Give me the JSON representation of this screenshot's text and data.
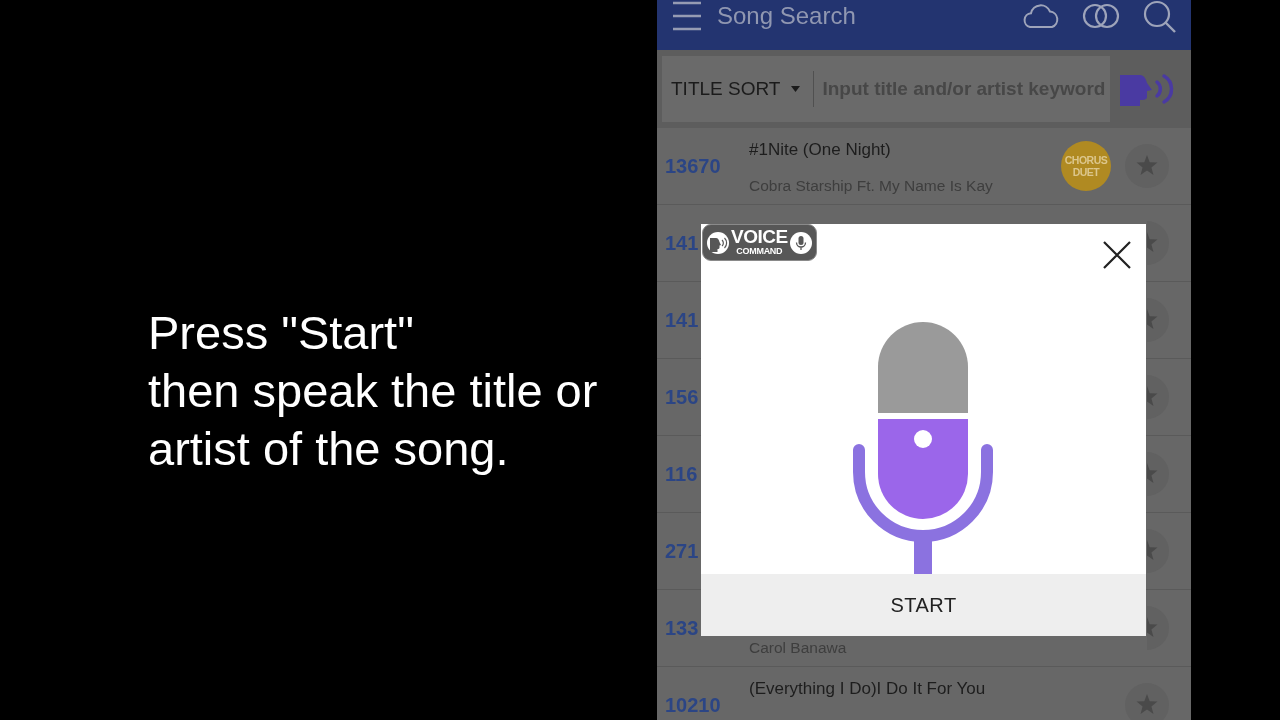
{
  "caption": {
    "text": "Press \"Start\"\nthen speak the title or\nartist of the song."
  },
  "app_bar": {
    "title": "Song Search"
  },
  "search": {
    "sort": "TITLE SORT",
    "placeholder": "Input title and/or artist keyword"
  },
  "songs": [
    {
      "number": "13670",
      "title": "#1Nite (One Night)",
      "artist": "Cobra Starship Ft. My Name Is Kay",
      "badge": {
        "text": "CHORUS\nDUET",
        "color": "#b08a22"
      }
    },
    {
      "number": "141"
    },
    {
      "number": "141"
    },
    {
      "number": "156"
    },
    {
      "number": "116"
    },
    {
      "number": "271"
    },
    {
      "number": "133",
      "artist": "Carol Banawa"
    },
    {
      "number": "10210",
      "title": "(Everything I Do)I Do It For You"
    }
  ],
  "dialog": {
    "badge": {
      "title": "VOICE",
      "subtitle": "COMMAND"
    },
    "button": "START"
  }
}
